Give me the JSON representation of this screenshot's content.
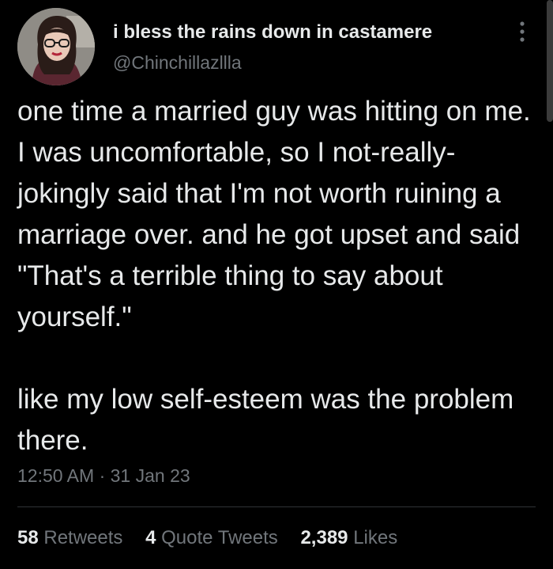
{
  "author": {
    "display_name": "i bless the rains down in castamere",
    "handle": "@Chinchillazllla",
    "avatar_icon": "profile-photo"
  },
  "tweet": {
    "paragraphs": [
      "one time a married guy was hitting on me. I was uncomfortable, so I not-really-jokingly said that I'm not worth ruining a marriage over. and he got upset and said \"That's a terrible thing to say about yourself.\"",
      "like my low self-esteem was the problem there."
    ],
    "time": "12:50 AM",
    "separator": "·",
    "date": "31 Jan 23"
  },
  "stats": {
    "retweets": {
      "count": "58",
      "label": "Retweets"
    },
    "quote_tweets": {
      "count": "4",
      "label": "Quote Tweets"
    },
    "likes": {
      "count": "2,389",
      "label": "Likes"
    }
  },
  "colors": {
    "background": "#000000",
    "text": "#e7e9ea",
    "secondary": "#71767b",
    "divider": "#2f3336"
  }
}
